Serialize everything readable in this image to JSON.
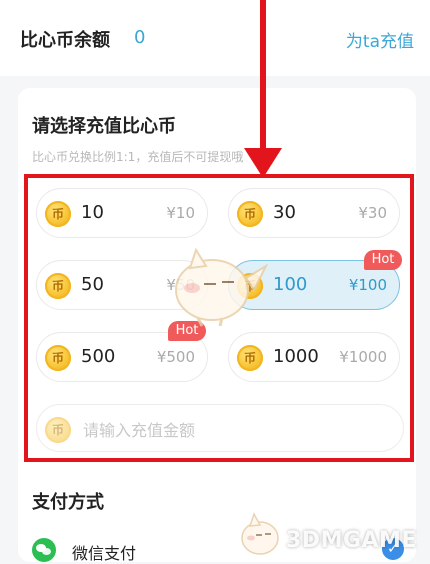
{
  "header": {
    "balance_label": "比心币余额",
    "balance_value": "0",
    "recharge_for_ta": "为ta充值"
  },
  "recharge": {
    "title": "请选择充值比心币",
    "subtitle": "比心币兑换比例1:1，充值后不可提现哦",
    "coin_glyph": "币",
    "hot_badge": "Hot",
    "options": [
      {
        "amount": "10",
        "price": "¥10"
      },
      {
        "amount": "30",
        "price": "¥30"
      },
      {
        "amount": "50",
        "price": "¥50"
      },
      {
        "amount": "100",
        "price": "¥100",
        "selected": true,
        "hot": true
      },
      {
        "amount": "500",
        "price": "¥500",
        "hot": true
      },
      {
        "amount": "1000",
        "price": "¥1000"
      }
    ],
    "custom_input": {
      "placeholder": "请输入充值金额",
      "value": ""
    }
  },
  "payment": {
    "title": "支付方式",
    "methods": [
      {
        "label": "微信支付",
        "icon": "wechat-icon",
        "selected": true
      }
    ]
  },
  "watermark": {
    "text": "3DMGAME"
  },
  "colors": {
    "accent_blue": "#3aa7d6",
    "selected_bg": "#dff0f8",
    "hot_red": "#f05a5a",
    "annotation_red": "#e3151c",
    "wechat_green": "#2bbf53"
  }
}
